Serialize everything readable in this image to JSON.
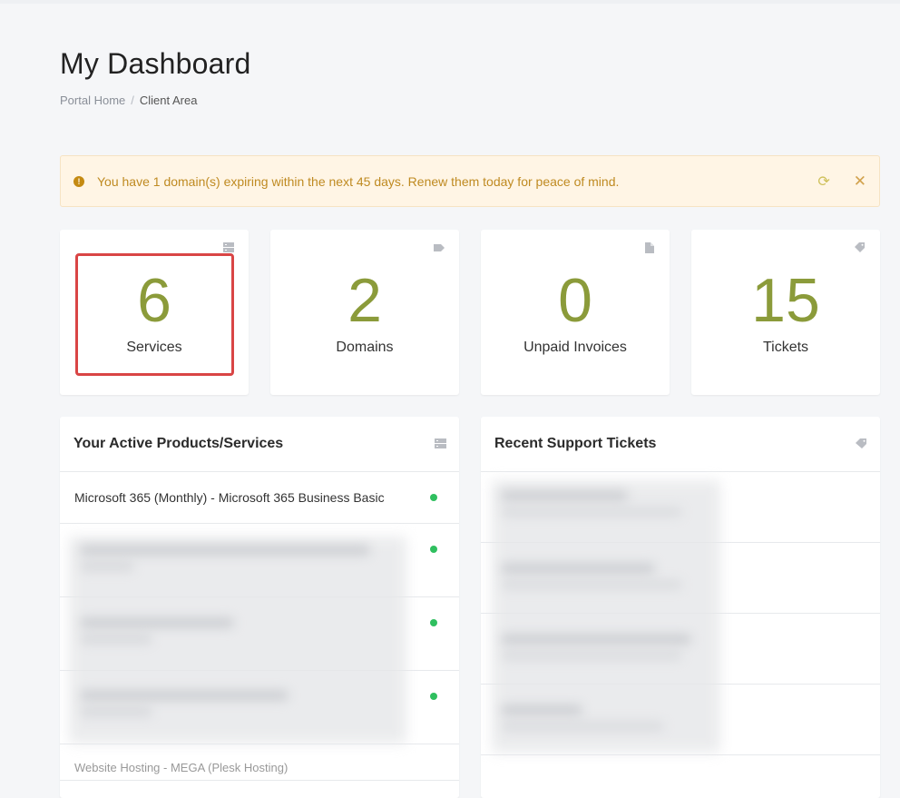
{
  "page": {
    "title": "My Dashboard"
  },
  "breadcrumb": {
    "home": "Portal Home",
    "separator": "/",
    "current": "Client Area"
  },
  "alert": {
    "icon": "exclamation-circle-icon",
    "message": "You have 1 domain(s) expiring within the next 45 days. Renew them today for peace of mind.",
    "renew_icon": "refresh-icon",
    "close_icon": "close-icon",
    "renew_symbol": "⟳",
    "close_symbol": "✕",
    "warn_symbol": "!"
  },
  "tiles": [
    {
      "value": "6",
      "label": "Services",
      "icon": "server-icon"
    },
    {
      "value": "2",
      "label": "Domains",
      "icon": "globe-tag-icon"
    },
    {
      "value": "0",
      "label": "Unpaid Invoices",
      "icon": "document-icon"
    },
    {
      "value": "15",
      "label": "Tickets",
      "icon": "tag-icon"
    }
  ],
  "colors": {
    "accent": "#8b9b3a",
    "status_active": "#2fbf5f",
    "highlight": "#d94545",
    "alert_text": "#bf8a21"
  },
  "services_panel": {
    "title": "Your Active Products/Services",
    "icon": "server-icon",
    "items": [
      {
        "name": "Microsoft 365 (Monthly) - Microsoft 365 Business Basic",
        "status": "active"
      }
    ],
    "partial_item": "Website Hosting - MEGA (Plesk Hosting)"
  },
  "tickets_panel": {
    "title": "Recent Support Tickets",
    "icon": "tag-icon"
  }
}
